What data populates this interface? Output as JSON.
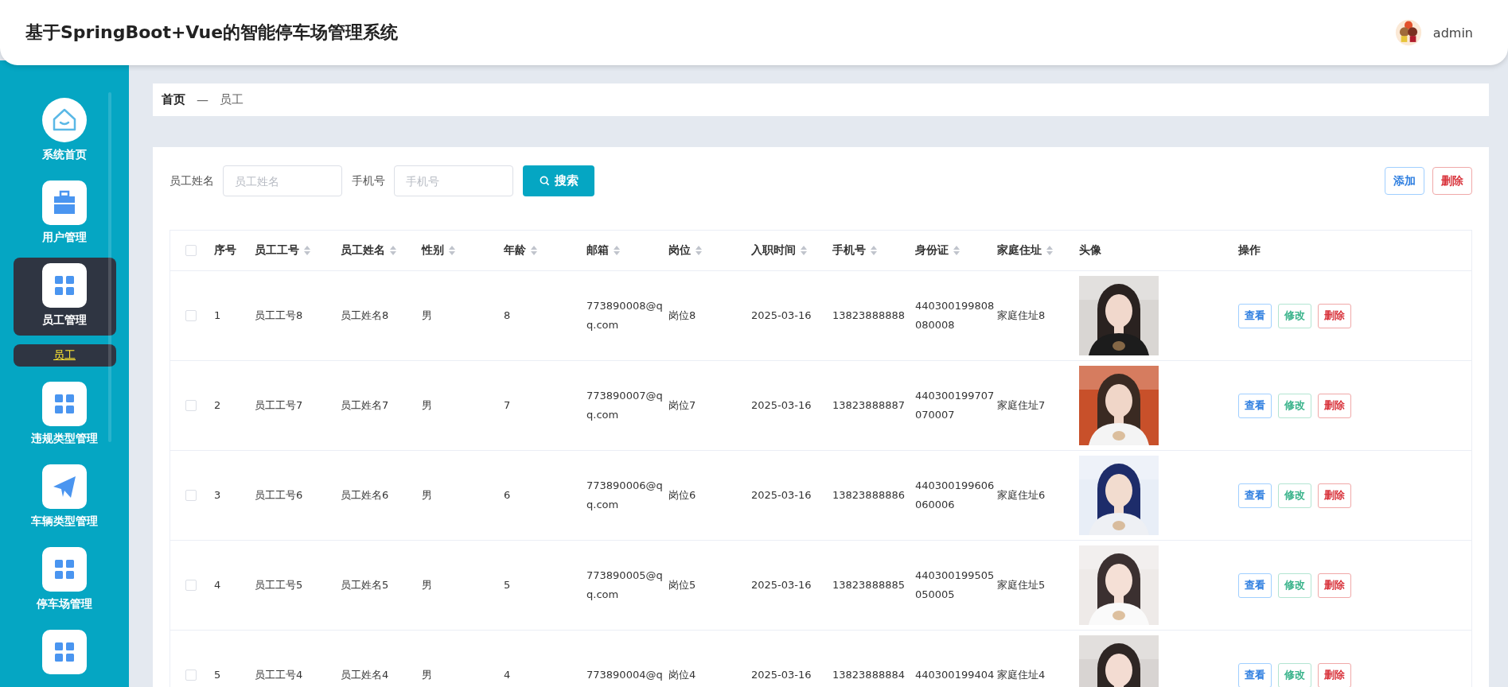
{
  "header": {
    "title": "基于SpringBoot+Vue的智能停车场管理系统",
    "user": "admin"
  },
  "sidebar": {
    "items": [
      {
        "kind": "home",
        "label": "系统首页",
        "selected": false
      },
      {
        "kind": "toolbox",
        "label": "用户管理",
        "selected": false
      },
      {
        "kind": "grid",
        "label": "员工管理",
        "selected": true,
        "children": [
          {
            "label": "员工",
            "selected": true
          }
        ]
      },
      {
        "kind": "grid",
        "label": "违规类型管理",
        "selected": false
      },
      {
        "kind": "plane",
        "label": "车辆类型管理",
        "selected": false
      },
      {
        "kind": "grid",
        "label": "停车场管理",
        "selected": false
      },
      {
        "kind": "grid",
        "selected": false
      }
    ]
  },
  "breadcrumb": {
    "items": [
      "首页",
      "员工"
    ],
    "separator": "—"
  },
  "search": {
    "fields": [
      {
        "label": "员工姓名",
        "placeholder": "员工姓名"
      },
      {
        "label": "手机号",
        "placeholder": "手机号"
      }
    ],
    "button": "搜索"
  },
  "actions": [
    {
      "kind": "add",
      "label": "添加"
    },
    {
      "kind": "delete",
      "label": "删除"
    }
  ],
  "table": {
    "select_all": {
      "checked": false
    },
    "columns": [
      {
        "label": "序号",
        "sortable": false
      },
      {
        "label": "员工工号",
        "sortable": true
      },
      {
        "label": "员工姓名",
        "sortable": true
      },
      {
        "label": "性别",
        "sortable": true
      },
      {
        "label": "年龄",
        "sortable": true
      },
      {
        "label": "邮箱",
        "sortable": true
      },
      {
        "label": "岗位",
        "sortable": true
      },
      {
        "label": "入职时间",
        "sortable": true
      },
      {
        "label": "手机号",
        "sortable": true
      },
      {
        "label": "身份证",
        "sortable": true
      },
      {
        "label": "家庭住址",
        "sortable": true
      },
      {
        "label": "头像",
        "sortable": false
      },
      {
        "label": "操作",
        "sortable": false
      }
    ],
    "rows": [
      {
        "checked": false,
        "cells": [
          "1",
          "员工工号8",
          "员工姓名8",
          "男",
          "8",
          [
            "773890008@q",
            "q.com"
          ],
          "岗位8",
          "2025-03-16",
          "13823888888",
          [
            "440300199808",
            "080008"
          ],
          "家庭住址8"
        ],
        "avatar": {
          "kind": "picture"
        },
        "buttons": [
          {
            "kind": "view",
            "label": "查看"
          },
          {
            "kind": "edit",
            "label": "修改"
          },
          {
            "kind": "delete",
            "label": "删除"
          }
        ]
      },
      {
        "checked": false,
        "cells": [
          "2",
          "员工工号7",
          "员工姓名7",
          "男",
          "7",
          [
            "773890007@q",
            "q.com"
          ],
          "岗位7",
          "2025-03-16",
          "13823888887",
          [
            "440300199707",
            "070007"
          ],
          "家庭住址7"
        ],
        "avatar": {
          "kind": "picture"
        },
        "buttons": [
          {
            "kind": "view",
            "label": "查看"
          },
          {
            "kind": "edit",
            "label": "修改"
          },
          {
            "kind": "delete",
            "label": "删除"
          }
        ]
      },
      {
        "checked": false,
        "cells": [
          "3",
          "员工工号6",
          "员工姓名6",
          "男",
          "6",
          [
            "773890006@q",
            "q.com"
          ],
          "岗位6",
          "2025-03-16",
          "13823888886",
          [
            "440300199606",
            "060006"
          ],
          "家庭住址6"
        ],
        "avatar": {
          "kind": "picture"
        },
        "buttons": [
          {
            "kind": "view",
            "label": "查看"
          },
          {
            "kind": "edit",
            "label": "修改"
          },
          {
            "kind": "delete",
            "label": "删除"
          }
        ]
      },
      {
        "checked": false,
        "cells": [
          "4",
          "员工工号5",
          "员工姓名5",
          "男",
          "5",
          [
            "773890005@q",
            "q.com"
          ],
          "岗位5",
          "2025-03-16",
          "13823888885",
          [
            "440300199505",
            "050005"
          ],
          "家庭住址5"
        ],
        "avatar": {
          "kind": "picture"
        },
        "buttons": [
          {
            "kind": "view",
            "label": "查看"
          },
          {
            "kind": "edit",
            "label": "修改"
          },
          {
            "kind": "delete",
            "label": "删除"
          }
        ]
      },
      {
        "checked": false,
        "cells": [
          "5",
          "员工工号4",
          "员工姓名4",
          "男",
          "4",
          [
            "773890004@q"
          ],
          "岗位4",
          "2025-03-16",
          "13823888884",
          [
            "440300199404"
          ],
          "家庭住址4"
        ],
        "avatar": {
          "kind": "picture"
        },
        "buttons": [
          {
            "kind": "view",
            "label": "查看"
          },
          {
            "kind": "edit",
            "label": "修改"
          },
          {
            "kind": "delete",
            "label": "删除"
          }
        ]
      }
    ]
  }
}
